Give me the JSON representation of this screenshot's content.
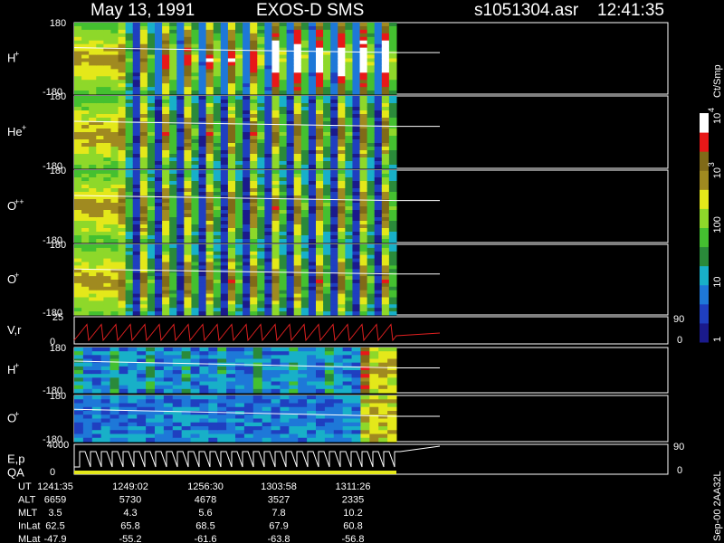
{
  "header": {
    "date": "May 13, 1991",
    "instrument": "EXOS-D SMS",
    "file": "s1051304.asr",
    "time": "12:41:35"
  },
  "chart_data": {
    "type": "heatmap",
    "panels": [
      {
        "label": "H",
        "sup": "+",
        "ylim": [
          -180,
          180
        ],
        "kind": "energy",
        "extra_top": 0,
        "extra_bottom": 0
      },
      {
        "label": "He",
        "sup": "+",
        "ylim": [
          -180,
          180
        ],
        "kind": "energy"
      },
      {
        "label": "O",
        "sup": "++",
        "ylim": [
          -180,
          180
        ],
        "kind": "energy"
      },
      {
        "label": "O",
        "sup": "+",
        "ylim": [
          -180,
          180
        ],
        "kind": "energy"
      },
      {
        "label": "V,r",
        "sup": "",
        "ylim": [
          0,
          25
        ],
        "kind": "line",
        "right_top": "90",
        "right_bottom": "0"
      },
      {
        "label": "H",
        "sup": "+",
        "ylim": [
          -180,
          180
        ],
        "kind": "angle"
      },
      {
        "label": "O",
        "sup": "+",
        "ylim": [
          -180,
          180
        ],
        "kind": "angle"
      },
      {
        "label": "E,p",
        "sub_label": "QA",
        "ylim": [
          0,
          4000
        ],
        "kind": "step",
        "right_top": "90",
        "right_bottom": "0"
      }
    ],
    "colorbar": {
      "unit": "Ct/Smp",
      "ticks": [
        {
          "label": "1",
          "value": 1
        },
        {
          "label": "10",
          "value": 10
        },
        {
          "label": "100",
          "value": 100
        },
        {
          "label": "10",
          "exp": "3",
          "value": 1000
        },
        {
          "label": "10",
          "exp": "4",
          "value": 10000
        }
      ]
    },
    "footer": {
      "rows": [
        {
          "name": "UT",
          "values": [
            "1241:35",
            "1249:02",
            "1256:30",
            "1303:58",
            "1311:26"
          ]
        },
        {
          "name": "ALT",
          "values": [
            "6659",
            "5730",
            "4678",
            "3527",
            "2335"
          ]
        },
        {
          "name": "MLT",
          "values": [
            "3.5",
            "4.3",
            "5.6",
            "7.8",
            "10.2"
          ]
        },
        {
          "name": "InLat",
          "values": [
            "62.5",
            "65.8",
            "68.5",
            "67.9",
            "60.8"
          ]
        },
        {
          "name": "MLat",
          "values": [
            "-47.9",
            "-55.2",
            "-61.6",
            "-63.8",
            "-56.8"
          ]
        }
      ]
    },
    "side_text": "Sep-00 2AA32L"
  }
}
